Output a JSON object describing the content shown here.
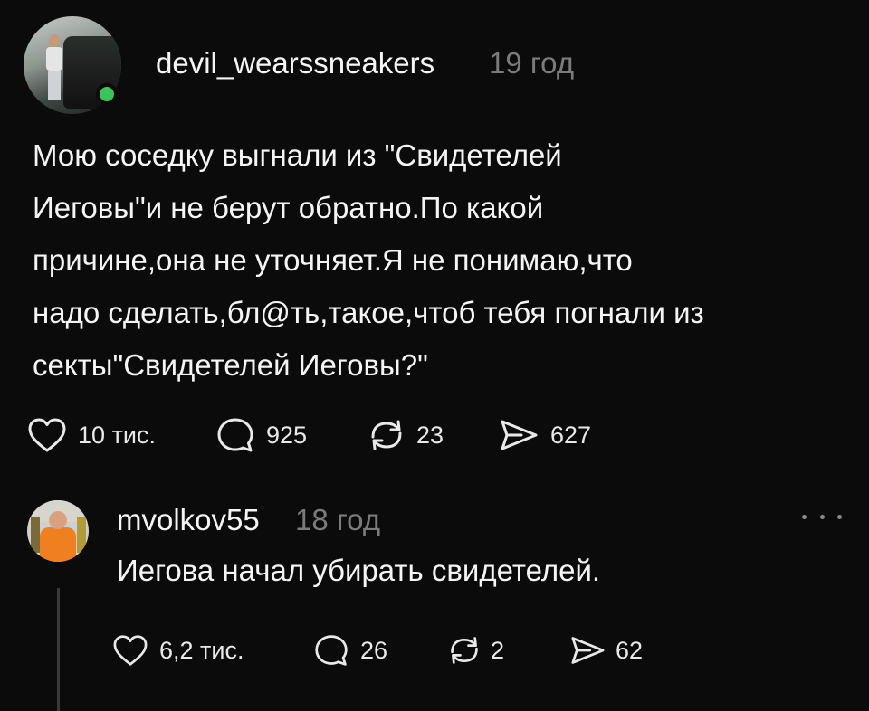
{
  "post": {
    "username": "devil_wearssneakers",
    "time": "19 год",
    "text_lines": [
      "Мою соседку выгнали из \"Свидетелей",
      "Иеговы\"и не берут обратно.По какой",
      "причине,она не уточняет.Я не понимаю,что",
      "надо сделать,бл@ть,такое,чтоб тебя погнали из",
      "секты\"Свидетелей Иеговы?\""
    ],
    "likes": "10 тис.",
    "comments": "925",
    "reposts": "23",
    "shares": "627"
  },
  "reply": {
    "username": "mvolkov55",
    "time": "18 год",
    "text": "Иегова начал убирать свидетелей.",
    "likes": "6,2 тис.",
    "comments": "26",
    "reposts": "2",
    "shares": "62"
  },
  "colors": {
    "background": "#0b0b0b",
    "text": "#f5f5f5",
    "muted": "#7b7b7b",
    "online": "#3ac55a"
  },
  "icons": [
    "heart-icon",
    "comment-icon",
    "repost-icon",
    "share-icon",
    "more-icon"
  ]
}
